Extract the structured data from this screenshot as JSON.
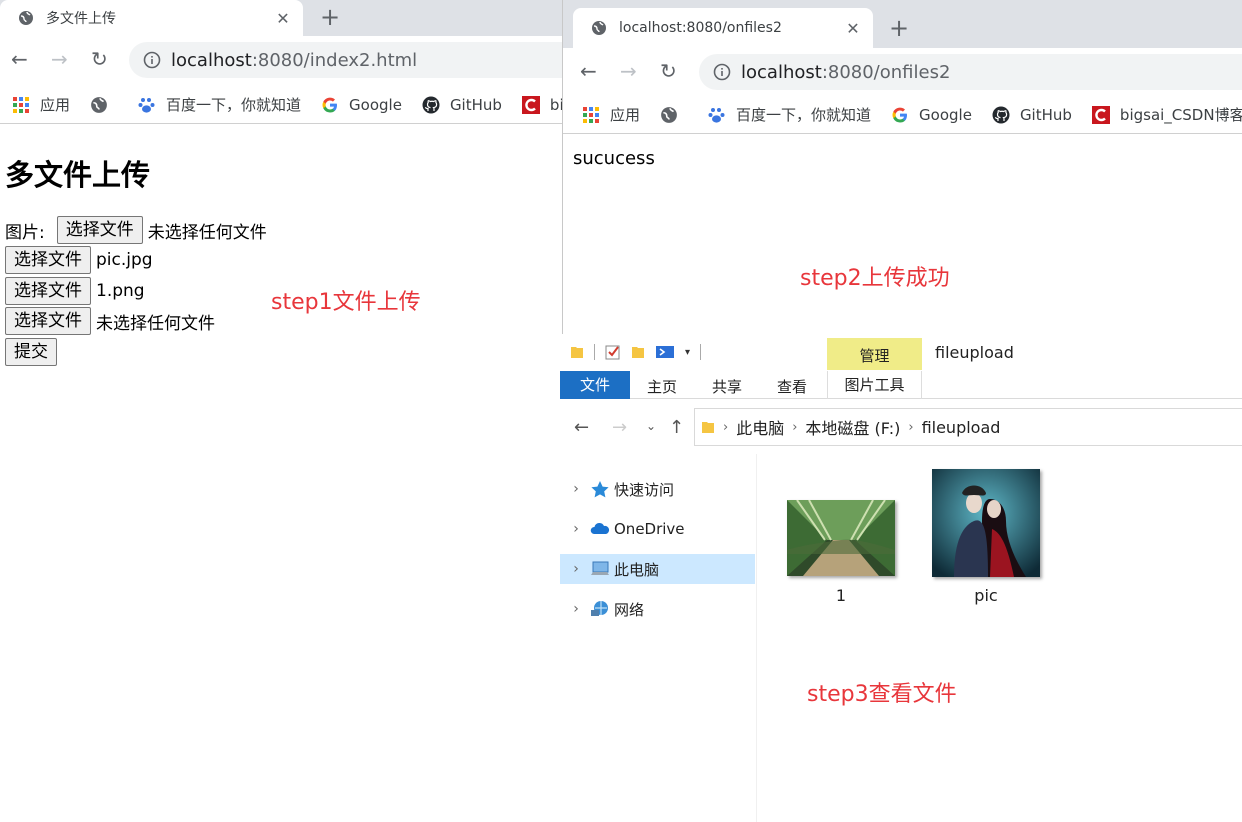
{
  "left_browser": {
    "tab_title": "多文件上传",
    "address": {
      "host": "localhost",
      "rest": ":8080/index2.html"
    },
    "bookmarks": [
      {
        "label": "应用",
        "icon": "apps-grid-icon"
      },
      {
        "label": "",
        "icon": "globe-icon"
      },
      {
        "label": "百度一下，你就知道",
        "icon": "baidu-paw-icon"
      },
      {
        "label": "Google",
        "icon": "google-g-icon"
      },
      {
        "label": "GitHub",
        "icon": "github-octocat-icon"
      },
      {
        "label": "bi",
        "icon": "csdn-c-icon"
      }
    ],
    "page": {
      "heading": "多文件上传",
      "image_label": "图片:",
      "choose_label": "选择文件",
      "file_inputs": [
        {
          "status": "未选择任何文件"
        },
        {
          "status": "pic.jpg"
        },
        {
          "status": "1.png"
        },
        {
          "status": "未选择任何文件"
        }
      ],
      "submit_label": "提交"
    }
  },
  "right_browser": {
    "tab_title": "localhost:8080/onfiles2",
    "address": {
      "host": "localhost",
      "rest": ":8080/onfiles2"
    },
    "bookmarks": [
      {
        "label": "应用",
        "icon": "apps-grid-icon"
      },
      {
        "label": "",
        "icon": "globe-icon"
      },
      {
        "label": "百度一下，你就知道",
        "icon": "baidu-paw-icon"
      },
      {
        "label": "Google",
        "icon": "google-g-icon"
      },
      {
        "label": "GitHub",
        "icon": "github-octocat-icon"
      },
      {
        "label": "bigsai_CSDN博客-",
        "icon": "csdn-c-icon"
      }
    ],
    "page_text": "sucucess"
  },
  "explorer": {
    "ribbon": {
      "manage_tab": "管理",
      "window_title": "fileupload",
      "tabs": [
        "文件",
        "主页",
        "共享",
        "查看"
      ],
      "picture_tools": "图片工具"
    },
    "breadcrumb": [
      "此电脑",
      "本地磁盘 (F:)",
      "fileupload"
    ],
    "nav_tree": [
      {
        "label": "快速访问",
        "icon": "star-quick-access-icon",
        "selected": false
      },
      {
        "label": "OneDrive",
        "icon": "onedrive-cloud-icon",
        "selected": false
      },
      {
        "label": "此电脑",
        "icon": "this-pc-icon",
        "selected": true
      },
      {
        "label": "网络",
        "icon": "network-icon",
        "selected": false
      }
    ],
    "files": [
      {
        "name": "1",
        "icon": "bamboo-image-thumbnail"
      },
      {
        "name": "pic",
        "icon": "portrait-image-thumbnail"
      }
    ]
  },
  "annotations": {
    "step1": "step1文件上传",
    "step2": "step2上传成功",
    "step3": "step3查看文件"
  },
  "colors": {
    "annotation_red": "#e8363b",
    "explorer_file_tab": "#1c6fc4",
    "manage_tab_bg": "#f0ec88",
    "selected_tree_bg": "#cce8ff"
  }
}
